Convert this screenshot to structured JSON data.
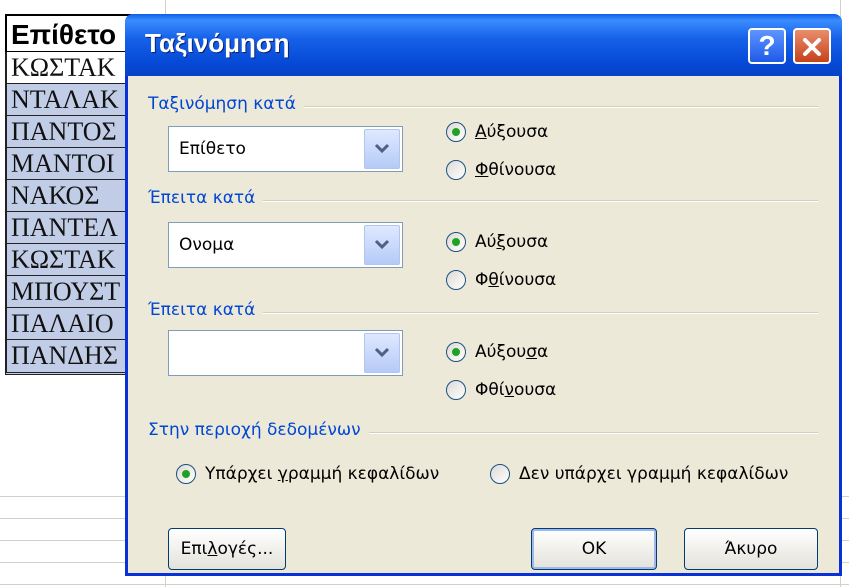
{
  "spreadsheet": {
    "header": "Επίθετο",
    "rows": [
      "ΚΩΣΤΑΚ",
      "ΝΤΑΛΑΚ",
      "ΠΑΝΤΟΣ",
      "ΜΑΝΤΟΙ",
      "ΝΑΚΟΣ ",
      "ΠΑΝΤΕΛ",
      "ΚΩΣΤΑΚ",
      "ΜΠΟΥΣΤ",
      "ΠΑΛΑΙΟ",
      "ΠΑΝΔΗΣ"
    ]
  },
  "dialog": {
    "title": "Ταξινόμηση",
    "help_icon": "question-mark-icon",
    "close_icon": "close-x-icon",
    "sort_by": {
      "label": "Ταξινόμηση κατά",
      "combo_value": "Επίθετο",
      "ascending": {
        "pre": "",
        "ul": "Α",
        "post": "ύξουσα"
      },
      "descending": {
        "pre": "",
        "ul": "Φ",
        "post": "θίνουσα"
      },
      "selected": "ascending"
    },
    "then_by_1": {
      "label": "Έπειτα κατά",
      "combo_value": "Ονομα",
      "ascending": {
        "pre": "Αύ",
        "ul": "ξ",
        "post": "ουσα"
      },
      "descending": {
        "pre": "Φ",
        "ul": "θ",
        "post": "ίνουσα"
      },
      "selected": "ascending"
    },
    "then_by_2": {
      "label": "Έπειτα κατά",
      "combo_value": "",
      "ascending": {
        "pre": "Αύξου",
        "ul": "σ",
        "post": "α"
      },
      "descending": {
        "pre": "Φθί",
        "ul": "ν",
        "post": "ουσα"
      },
      "selected": "ascending"
    },
    "data_range": {
      "label": "Στην περιοχή δεδομένων",
      "has_header": {
        "pre": "Υπάρχει ",
        "ul": "γ",
        "post": "ραμμή κεφαλίδων"
      },
      "no_header": {
        "pre": "Δεν υπάρ",
        "ul": "χ",
        "post": "ει γραμμή κεφαλίδων"
      },
      "selected": "has_header"
    },
    "buttons": {
      "options": {
        "pre": "Επι",
        "ul": "λ",
        "post": "ογές..."
      },
      "ok": "OK",
      "cancel": "Άκυρο"
    },
    "colors": {
      "titlebar": "#0a5fe8",
      "section_label": "#0046d5",
      "radio_checked": "#21a121",
      "close_button": "#c6421c",
      "selection": "#c1cde6"
    }
  }
}
